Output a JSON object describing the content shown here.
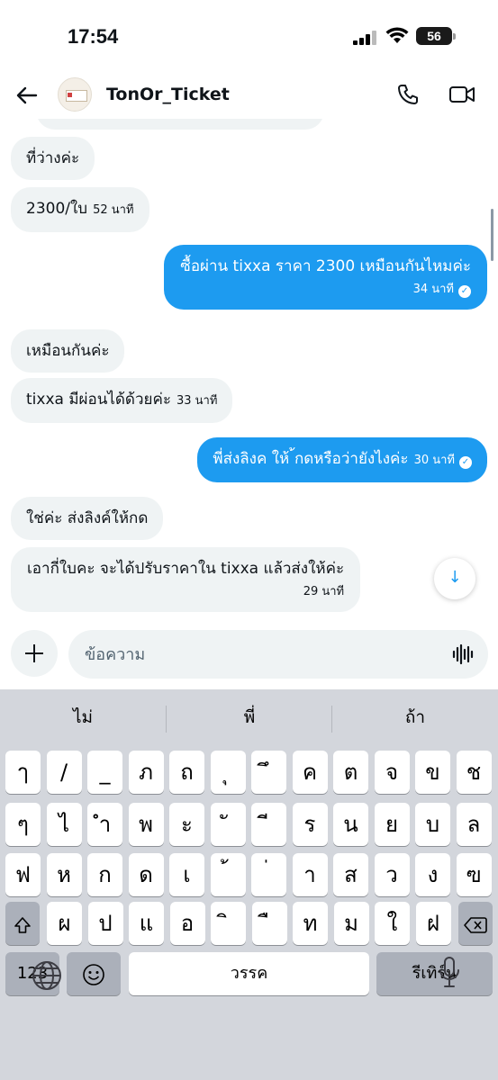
{
  "status": {
    "time": "17:54",
    "battery": "56"
  },
  "header": {
    "name": "TonOr_Ticket"
  },
  "messages": {
    "m1": {
      "text": "ที่ว่างค่ะ"
    },
    "m2": {
      "text": "2300/ใบ",
      "time": "52 นาที"
    },
    "m3": {
      "text": "ซื้อผ่าน tixxa ราคา 2300 เหมือนกันไหมค่ะ",
      "time": "34 นาที"
    },
    "m4": {
      "text": "เหมือนกันค่ะ"
    },
    "m5": {
      "text": "tixxa มีผ่อนได้ด้วยค่ะ",
      "time": "33 นาที"
    },
    "m6": {
      "text": "พี่ส่งลิงค ให้ ้กดหรือว่ายังไงค่ะ",
      "time": "30 นาที"
    },
    "m7": {
      "text": "ใช่ค่ะ ส่งลิงค์ให้กด"
    },
    "m8": {
      "text": "เอากี่ใบคะ จะได้ปรับราคาใน tixxa แล้วส่งให้ค่ะ",
      "time": "29 นาที"
    }
  },
  "composer": {
    "placeholder": "ข้อความ"
  },
  "keyboard": {
    "suggestions": [
      "ไม่",
      "พี่",
      "ถ้า"
    ],
    "row1": [
      "ๅ",
      "/",
      "_",
      "ภ",
      "ถ",
      "ุ",
      "ึ",
      "ค",
      "ต",
      "จ",
      "ข",
      "ช"
    ],
    "row2": [
      "ๆ",
      "ไ",
      "ำ",
      "พ",
      "ะ",
      "ั",
      "ี",
      "ร",
      "น",
      "ย",
      "บ",
      "ล"
    ],
    "row3": [
      "ฟ",
      "ห",
      "ก",
      "ด",
      "เ",
      "้",
      "่",
      "า",
      "ส",
      "ว",
      "ง",
      "ฃ"
    ],
    "row4": [
      "ผ",
      "ป",
      "แ",
      "อ",
      "ิ",
      "ื",
      "ท",
      "ม",
      "ใ",
      "ฝ"
    ],
    "numbers_label": "123",
    "space_label": "วรรค",
    "return_label": "รีเทิร์น"
  },
  "colors": {
    "accent": "#1d9bf0",
    "incoming_bubble": "#eff3f4",
    "keyboard_bg": "#d3d6dc"
  },
  "icons": [
    "back-arrow-icon",
    "phone-icon",
    "video-icon",
    "plus-icon",
    "voice-wave-icon",
    "arrow-down-icon",
    "shift-icon",
    "backspace-icon",
    "emoji-icon",
    "globe-icon",
    "microphone-icon"
  ]
}
